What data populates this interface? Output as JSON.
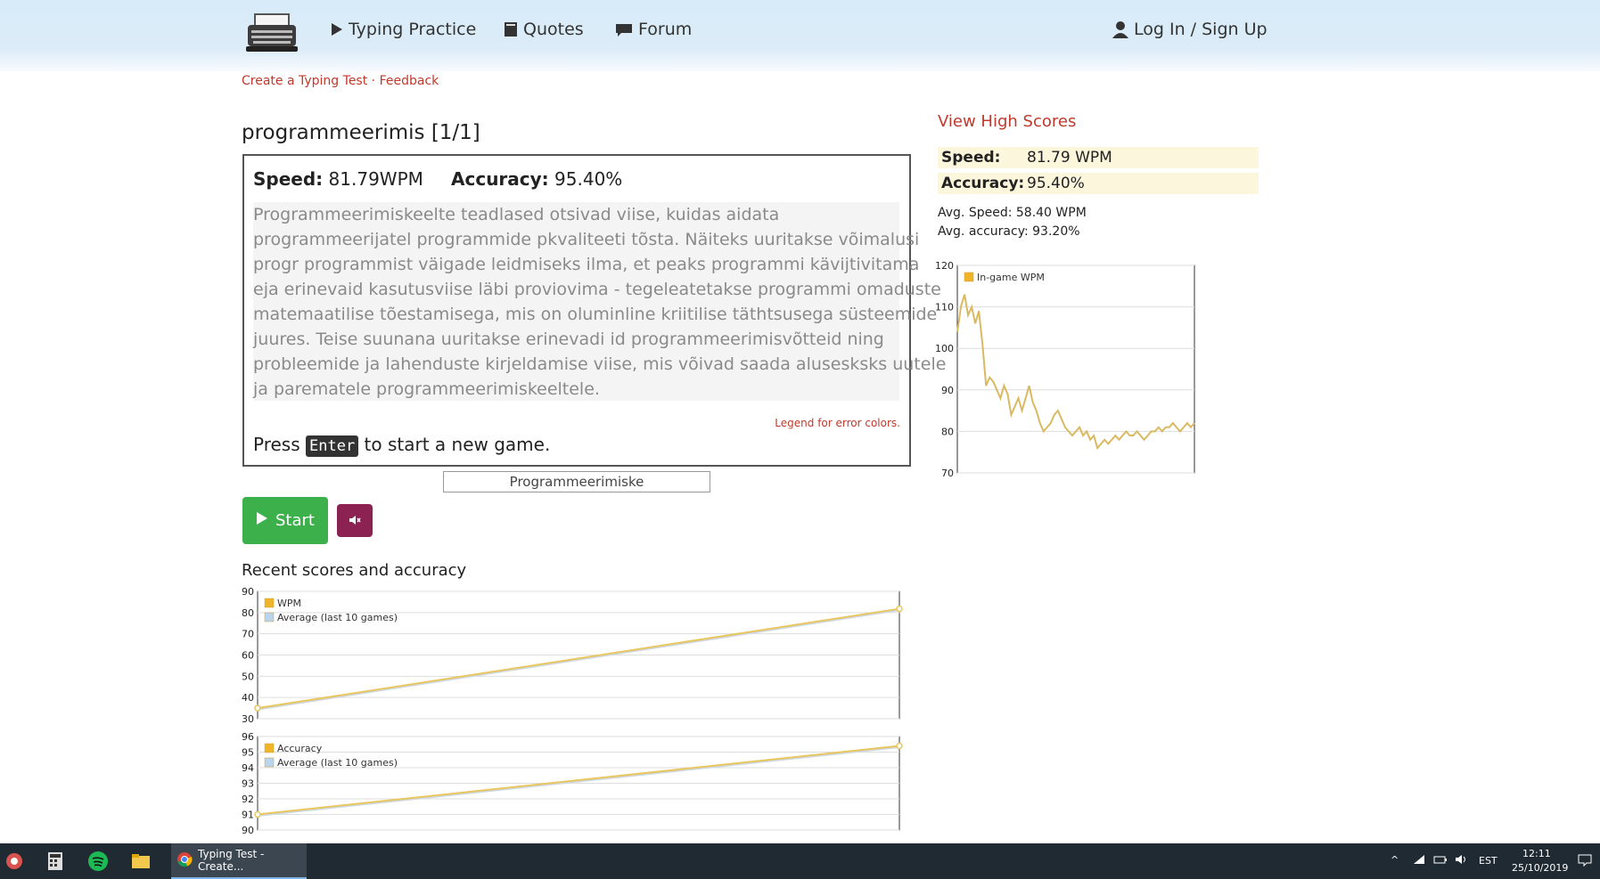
{
  "header": {
    "nav": [
      {
        "label": "Typing Practice",
        "icon": "play-icon"
      },
      {
        "label": "Quotes",
        "icon": "book-icon"
      },
      {
        "label": "Forum",
        "icon": "comment-icon"
      }
    ],
    "login_label": "Log In / Sign Up"
  },
  "sublinks": {
    "create": "Create a Typing Test",
    "sep": " · ",
    "feedback": "Feedback"
  },
  "test": {
    "title": "programmeerimis [1/1]",
    "speed_label": "Speed:",
    "speed_value": "81.79WPM",
    "accuracy_label": "Accuracy:",
    "accuracy_value": "95.40%",
    "legend_link": "Legend for error colors.",
    "press_before": "Press",
    "press_key": "Enter",
    "press_after": "to start a new game.",
    "input_value": "Programmeerimiske"
  },
  "passage_lines": [
    "Programmeerimiskeelte teadlased otsivad viise, kuidas aidata",
    "programmeerijatel programmide pkvaliteeti tõsta. Näiteks uuritakse võimalusi",
    "progr programmist väigade leidmiseks ilma, et peaks programmi kävijtivitama",
    "eja erinevaid kasutusviise läbi proviovima - tegeleatetakse programmi omaduste",
    "matemaatilise tõestamisega, mis on oluminline kriitilise täthtsusega süsteemide",
    "juures. Teise suunana uuritakse erinevadi id programmeerimisvõtteid ning",
    "probleemide ja lahenduste kirjeldamise viise, mis võivad saada alusesksks uutele",
    "ja parematele programmeerimiskeeltele."
  ],
  "controls": {
    "start_label": "Start"
  },
  "recent": {
    "title": "Recent scores and accuracy"
  },
  "right": {
    "high_scores": "View High Scores",
    "speed_label": "Speed:",
    "speed_value": "81.79 WPM",
    "accuracy_label": "Accuracy:",
    "accuracy_value": "95.40%",
    "avg_speed": "Avg. Speed: 58.40 WPM",
    "avg_accuracy": "Avg. accuracy: 93.20%"
  },
  "taskbar": {
    "active_window": "Typing Test - Create...",
    "lang": "EST",
    "time": "12:11",
    "date": "25/10/2019"
  },
  "chart_data": [
    {
      "type": "line",
      "legend": [
        "In-game WPM"
      ],
      "ylim": [
        70,
        120
      ],
      "yticks": [
        120,
        110,
        100,
        90,
        80,
        70
      ],
      "series": [
        {
          "name": "In-game WPM",
          "color": "#e0c070",
          "values": [
            104,
            110,
            113,
            108,
            110,
            106,
            109,
            101,
            91,
            93,
            92,
            90,
            88,
            91,
            89,
            84,
            86,
            88,
            85,
            88,
            91,
            87,
            85,
            82,
            80,
            81,
            82,
            84,
            85,
            83,
            81,
            80,
            79,
            80,
            81,
            79,
            80,
            78,
            79,
            76,
            77,
            78,
            77,
            78,
            79,
            78,
            79,
            80,
            79,
            79,
            80,
            79,
            78,
            79,
            80,
            80,
            81,
            80,
            81,
            81,
            82,
            81,
            80,
            81,
            82,
            81,
            82
          ]
        }
      ]
    },
    {
      "type": "line",
      "legend": [
        "WPM",
        "Average (last 10 games)"
      ],
      "ylim": [
        30,
        90
      ],
      "yticks": [
        90,
        80,
        70,
        60,
        50,
        40,
        30
      ],
      "series": [
        {
          "name": "WPM",
          "values": [
            35.0,
            81.79
          ]
        },
        {
          "name": "Average (last 10 games)",
          "values": [
            35.0,
            81.79
          ]
        }
      ]
    },
    {
      "type": "line",
      "legend": [
        "Accuracy",
        "Average (last 10 games)"
      ],
      "ylim": [
        90,
        96
      ],
      "yticks": [
        96,
        95,
        94,
        93,
        92,
        91,
        90
      ],
      "series": [
        {
          "name": "Accuracy",
          "values": [
            91.0,
            95.4
          ]
        },
        {
          "name": "Average (last 10 games)",
          "values": [
            91.0,
            95.4
          ]
        }
      ]
    }
  ]
}
